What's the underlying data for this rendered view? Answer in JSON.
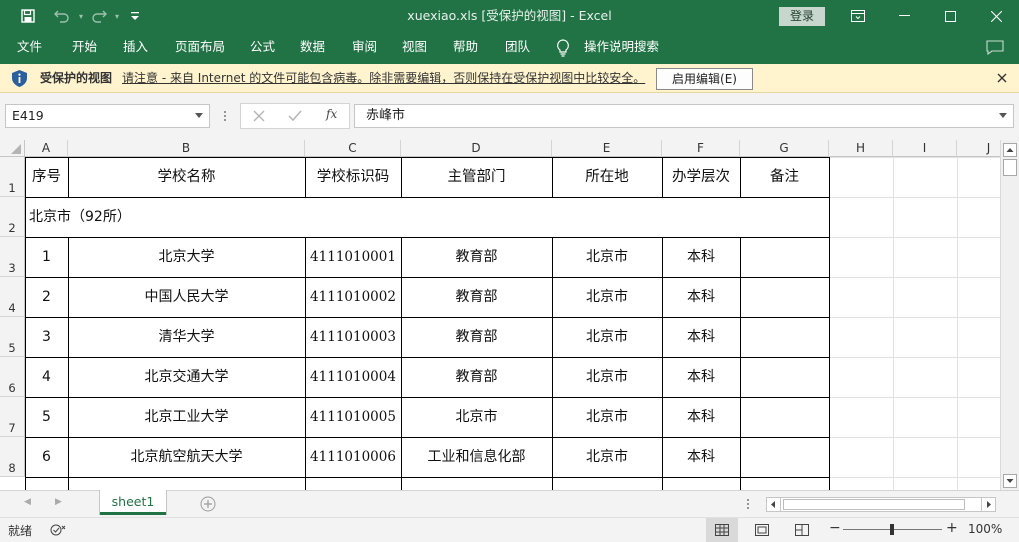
{
  "title_bar": {
    "title": "xuexiao.xls  [受保护的视图]  -  Excel",
    "login_label": "登录"
  },
  "menu": {
    "items": [
      "文件",
      "开始",
      "插入",
      "页面布局",
      "公式",
      "数据",
      "审阅",
      "视图",
      "帮助",
      "团队",
      "操作说明搜索"
    ]
  },
  "protected_bar": {
    "title": "受保护的视图",
    "message": "请注意 - 来自 Internet 的文件可能包含病毒。除非需要编辑，否则保持在受保护视图中比较安全。",
    "enable_button": "启用编辑(E)"
  },
  "formula_bar": {
    "name_box": "E419",
    "fx_label": "fx",
    "formula": "赤峰市"
  },
  "grid": {
    "columns": [
      "A",
      "B",
      "C",
      "D",
      "E",
      "F",
      "G",
      "H",
      "I",
      "J"
    ],
    "rows": [
      "1",
      "2",
      "3",
      "4",
      "5",
      "6",
      "7",
      "8"
    ],
    "headers": [
      "序号",
      "学校名称",
      "学校标识码",
      "主管部门",
      "所在地",
      "办学层次",
      "备注"
    ],
    "section_title": "北京市（92所）",
    "records": [
      [
        "1",
        "北京大学",
        "4111010001",
        "教育部",
        "北京市",
        "本科",
        ""
      ],
      [
        "2",
        "中国人民大学",
        "4111010002",
        "教育部",
        "北京市",
        "本科",
        ""
      ],
      [
        "3",
        "清华大学",
        "4111010003",
        "教育部",
        "北京市",
        "本科",
        ""
      ],
      [
        "4",
        "北京交通大学",
        "4111010004",
        "教育部",
        "北京市",
        "本科",
        ""
      ],
      [
        "5",
        "北京工业大学",
        "4111010005",
        "北京市",
        "北京市",
        "本科",
        ""
      ],
      [
        "6",
        "北京航空航天大学",
        "4111010006",
        "工业和信息化部",
        "北京市",
        "本科",
        ""
      ]
    ]
  },
  "sheet_tabs": {
    "tabs": [
      "sheet1"
    ]
  },
  "status_bar": {
    "ready": "就绪",
    "zoom": "100%"
  }
}
